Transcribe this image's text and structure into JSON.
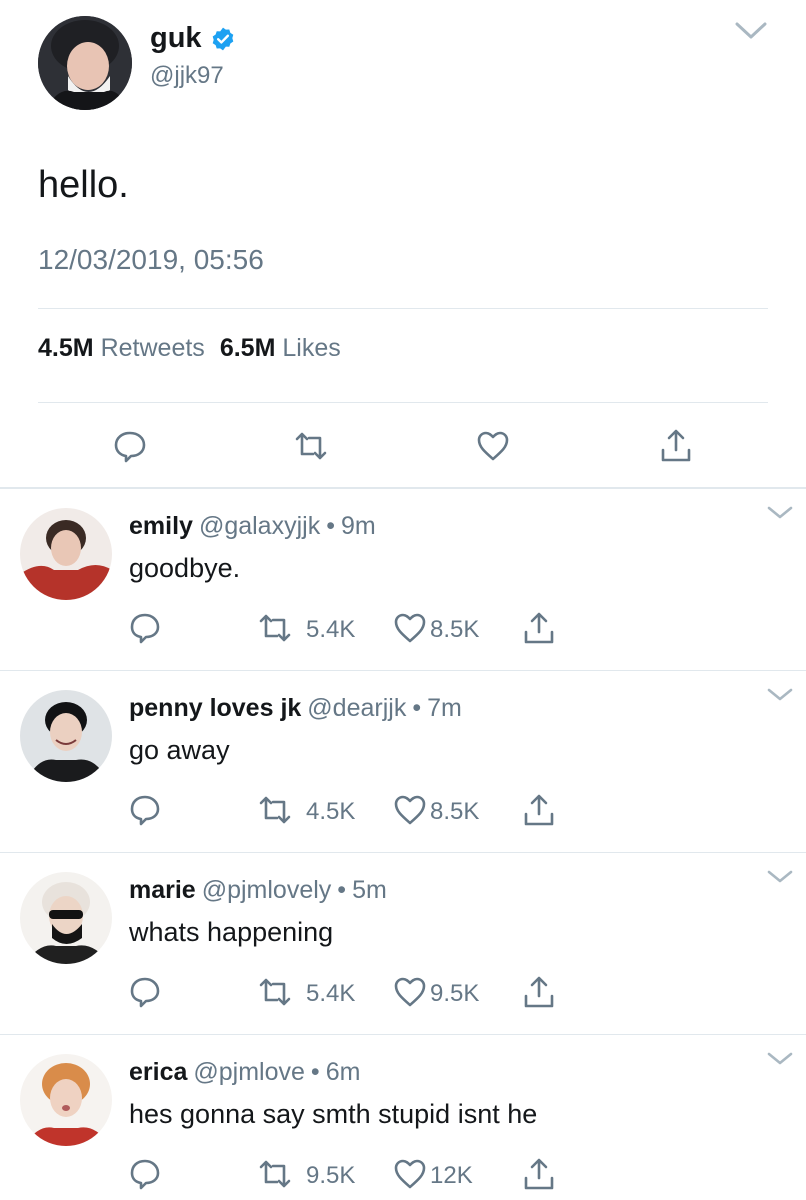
{
  "main_tweet": {
    "name": "guk",
    "verified": true,
    "handle": "@jjk97",
    "text": "hello.",
    "timestamp": "12/03/2019, 05:56",
    "retweets_count": "4.5M",
    "retweets_label": "Retweets",
    "likes_count": "6.5M",
    "likes_label": "Likes",
    "actions": [
      "reply-icon",
      "retweet-icon",
      "like-icon",
      "share-icon"
    ]
  },
  "replies": [
    {
      "name": "emily",
      "handle": "@galaxyjjk",
      "time": "9m",
      "text": "goodbye.",
      "retweets": "5.4K",
      "likes": "8.5K"
    },
    {
      "name": "penny loves jk",
      "handle": "@dearjjk",
      "time": "7m",
      "text": "go away",
      "retweets": "4.5K",
      "likes": "8.5K"
    },
    {
      "name": "marie",
      "handle": "@pjmlovely",
      "time": "5m",
      "text": "whats happening",
      "retweets": "5.4K",
      "likes": "9.5K"
    },
    {
      "name": "erica",
      "handle": "@pjmlove",
      "time": "6m",
      "text": "hes gonna say smth stupid isnt he",
      "retweets": "9.5K",
      "likes": "12K"
    }
  ],
  "separator": "•",
  "colors": {
    "primary_text": "#14171a",
    "secondary_text": "#657786",
    "divider": "#e1e8ed",
    "verified_blue": "#1da1f2"
  }
}
